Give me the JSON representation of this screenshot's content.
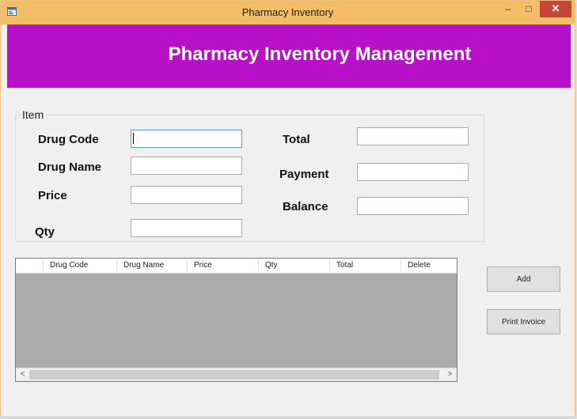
{
  "window": {
    "title": "Pharmacy Inventory",
    "minimize_glyph": "–",
    "maximize_glyph": "□",
    "close_glyph": "✕"
  },
  "banner": {
    "title": "Pharmacy Inventory Management"
  },
  "item_group": {
    "label": "Item",
    "fields": {
      "drug_code": {
        "label": "Drug Code",
        "value": ""
      },
      "drug_name": {
        "label": "Drug Name",
        "value": ""
      },
      "price": {
        "label": "Price",
        "value": ""
      },
      "qty": {
        "label": "Qty",
        "value": ""
      },
      "total": {
        "label": "Total",
        "value": ""
      },
      "payment": {
        "label": "Payment",
        "value": ""
      },
      "balance": {
        "label": "Balance",
        "value": ""
      }
    }
  },
  "grid": {
    "columns": [
      "Drug Code",
      "Drug Name",
      "Price",
      "Qty",
      "Total",
      "Delete"
    ],
    "rows": [],
    "scroll_left": "<",
    "scroll_right": ">"
  },
  "buttons": {
    "add": "Add",
    "print_invoice": "Print Invoice"
  },
  "colors": {
    "banner": "#b80fc8",
    "titlebar": "#f3be66",
    "close": "#c7463b",
    "grid_background": "#ababab"
  },
  "icons": {
    "app": "form-icon"
  }
}
